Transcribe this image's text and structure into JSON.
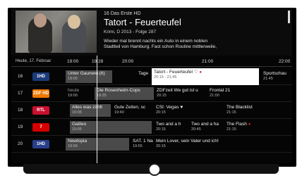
{
  "hero": {
    "channel": "16 Das Erste HD",
    "title": "Tatort - Feuerteufel",
    "subtitle": "Krimi, D 2013 - Folge 287",
    "description_line1": "Wieder mal brennt nachts ein Auto in einem noblen",
    "description_line2": "Stadtteil von Hamburg. Fast schon Routine mittlerweile,"
  },
  "timebar": {
    "date": "Heute, 17. Februar",
    "times": [
      "19:00",
      "19:28",
      "20:00",
      "21:00",
      "22:00"
    ]
  },
  "rows": [
    {
      "num": "16",
      "logo": "1HD",
      "logo_color": "#1b3a7a",
      "cells": [
        {
          "t": "Unter Gauner̵n (6)",
          "s": "19:00"
        },
        {
          "t": "Tage",
          "s": ""
        },
        {
          "t": "Tatort - Feuerteufel",
          "s": "20:15 - 21:45",
          "heart": "♡"
        },
        {
          "t": "Sportschau",
          "s": "21:45"
        }
      ]
    },
    {
      "num": "17",
      "logo": "ZDF HD",
      "logo_color": "#f07800",
      "cells": [
        {
          "t": "heute",
          "s": "19:00"
        },
        {
          "t": "Die Rosenheim-Cops",
          "s": "19:25"
        },
        {
          "t": "ZDFzeit We gut ist u",
          "s": "20:15"
        },
        {
          "t": "Frontal 21",
          "s": "21:00"
        }
      ]
    },
    {
      "num": "18",
      "logo": "RTL",
      "logo_color": "#c8102e",
      "cells": [
        {
          "t": "Alles was zählt",
          "s": "19:05"
        },
        {
          "t": "Gute Zeiten, sc",
          "s": "19:40"
        },
        {
          "t": "CSI: Vegas",
          "s": "20:15",
          "heart": "♥"
        },
        {
          "t": "The Blacklist",
          "s": "21:15"
        }
      ]
    },
    {
      "num": "19",
      "logo": "7",
      "logo_color": "#d40000",
      "cells": [
        {
          "t": "Galileo",
          "s": "19:05"
        },
        {
          "t": "Two and a h",
          "s": "20:15"
        },
        {
          "t": "Two and a ha",
          "s": "20:45"
        },
        {
          "t": "The Flash",
          "s": "21:15"
        }
      ]
    },
    {
      "num": "20",
      "logo": "1HD",
      "logo_color": "#2a3f8a",
      "cells": [
        {
          "t": "Newtopia",
          "s": "19:00"
        },
        {
          "t": "SAT. 1 Nach",
          "s": "19:55"
        },
        {
          "t": "Mein Lover, sein Vater und ich!",
          "s": "20:15"
        }
      ]
    }
  ]
}
